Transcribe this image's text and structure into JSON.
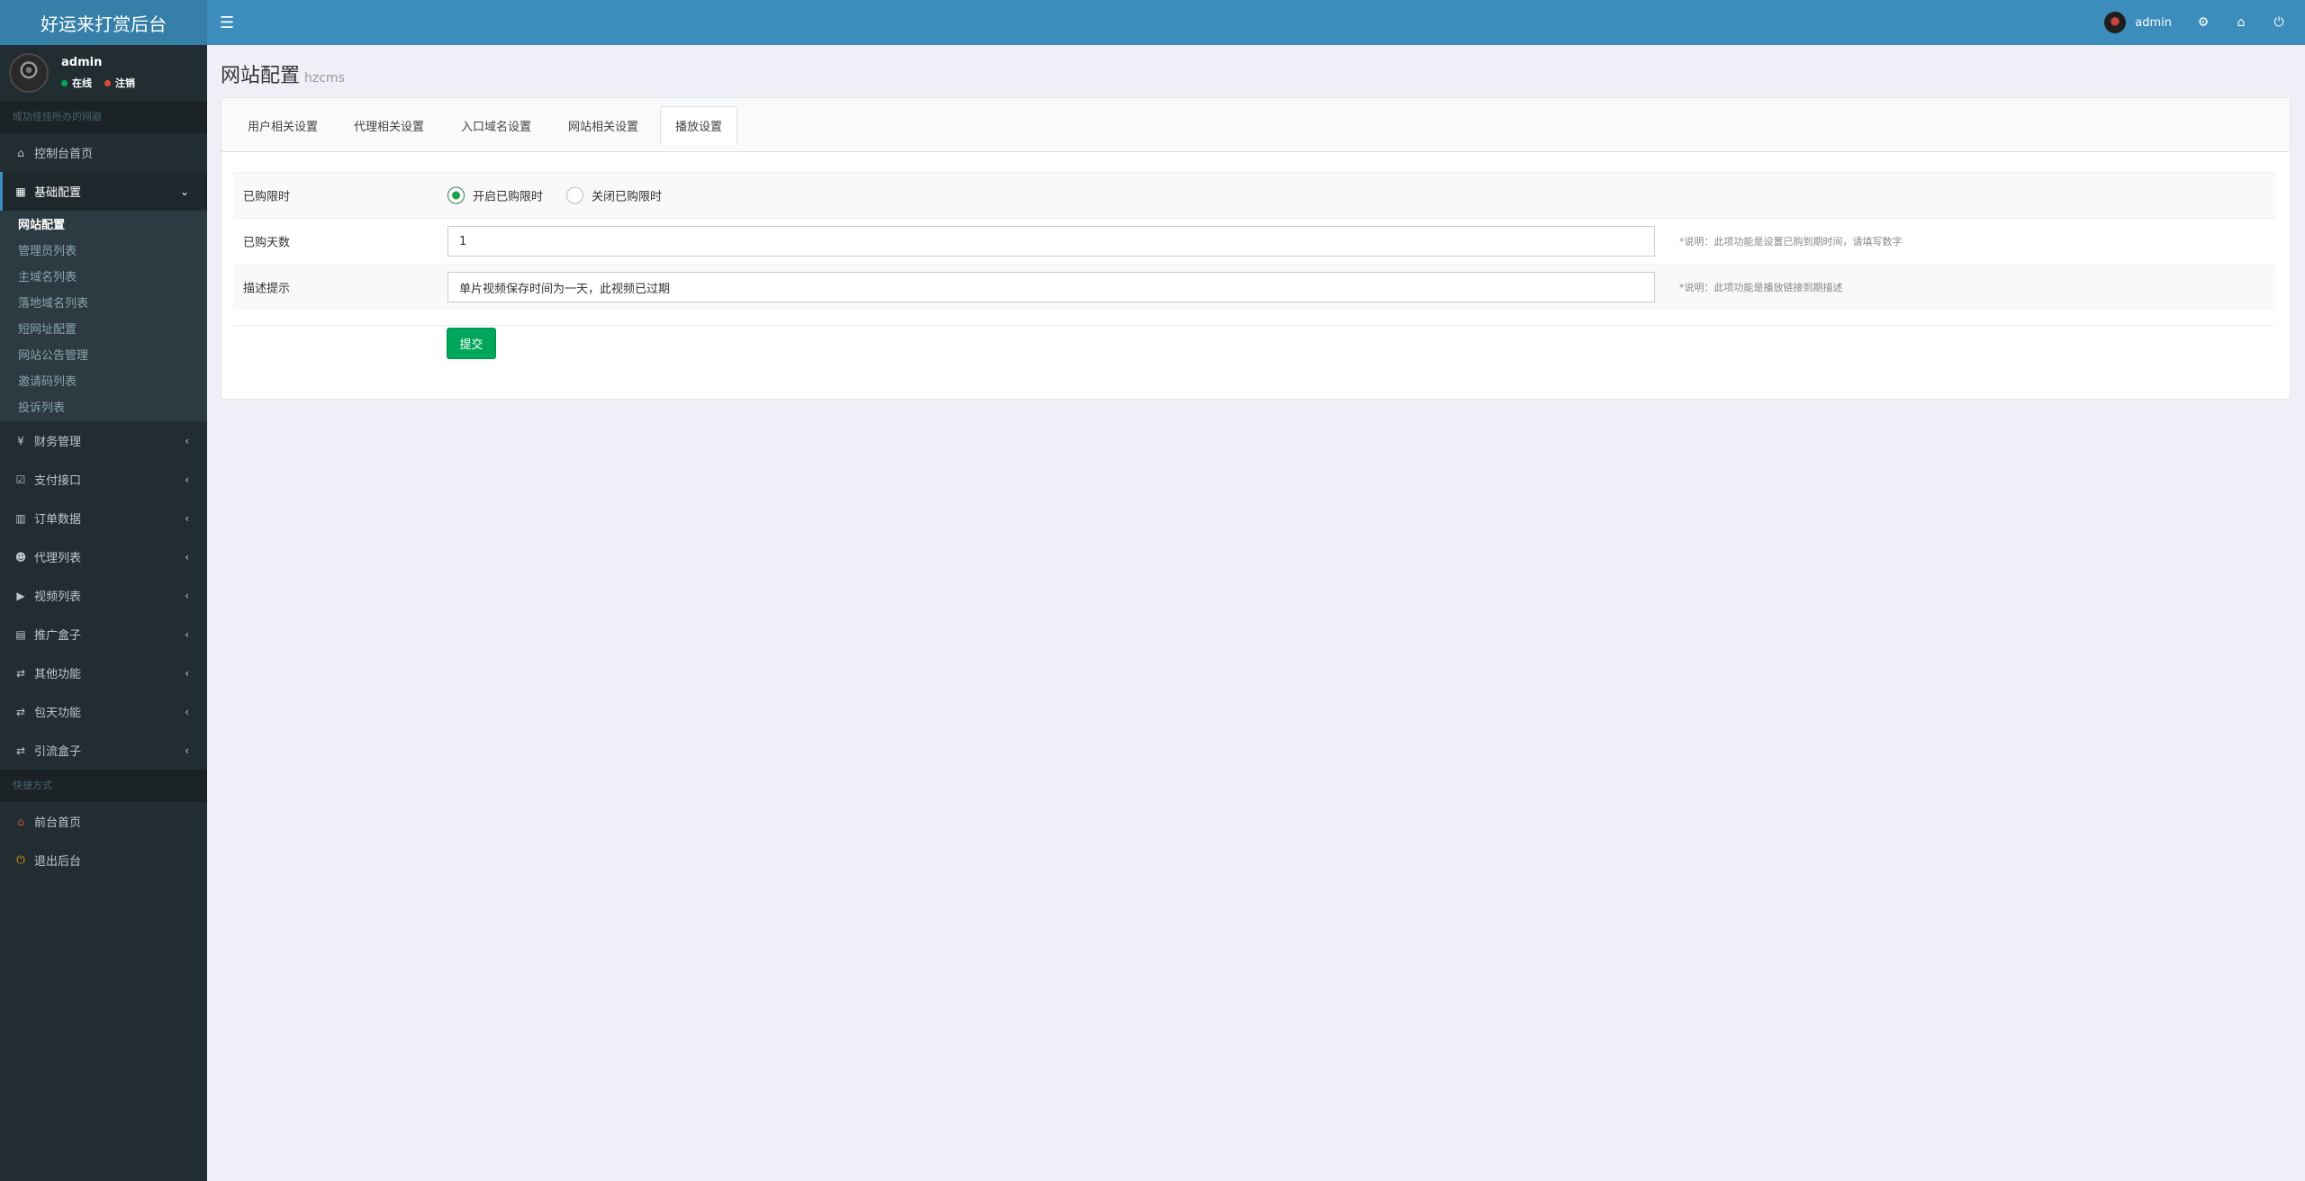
{
  "app": {
    "title": "好运来打赏后台"
  },
  "header": {
    "user_name": "admin"
  },
  "sidebar": {
    "user": {
      "name": "admin",
      "online_label": "在线",
      "logout_label": "注销"
    },
    "section_title": "成功佳佳所办的网避",
    "items": [
      {
        "icon": "dashboard-icon",
        "glyph": "⌂",
        "label": "控制台首页"
      },
      {
        "icon": "grid-icon",
        "glyph": "▦",
        "label": "基础配置",
        "expanded": true
      }
    ],
    "submenu": [
      {
        "label": "网站配置",
        "current": true
      },
      {
        "label": "管理员列表"
      },
      {
        "label": "主域名列表"
      },
      {
        "label": "落地域名列表"
      },
      {
        "label": "短网址配置"
      },
      {
        "label": "网站公告管理"
      },
      {
        "label": "邀请码列表"
      },
      {
        "label": "投诉列表"
      }
    ],
    "items2": [
      {
        "icon": "yen-icon",
        "glyph": "¥",
        "label": "财务管理"
      },
      {
        "icon": "check-square-icon",
        "glyph": "☑",
        "label": "支付接口"
      },
      {
        "icon": "bar-chart-icon",
        "glyph": "▥",
        "label": "订单数据"
      },
      {
        "icon": "users-icon",
        "glyph": "☻",
        "label": "代理列表"
      },
      {
        "icon": "video-icon",
        "glyph": "▶",
        "label": "视频列表"
      },
      {
        "icon": "table-icon",
        "glyph": "▤",
        "label": "推广盒子"
      },
      {
        "icon": "retweet-icon",
        "glyph": "⇄",
        "label": "其他功能"
      },
      {
        "icon": "retweet-icon",
        "glyph": "⇄",
        "label": "包天功能"
      },
      {
        "icon": "retweet-icon",
        "glyph": "⇄",
        "label": "引流盒子"
      }
    ],
    "shortcut_title": "快捷方式",
    "shortcuts": [
      {
        "icon": "home-icon",
        "glyph": "⌂",
        "label": "前台首页",
        "color": "#dd4b39"
      },
      {
        "icon": "power-icon",
        "glyph": "⏻",
        "label": "退出后台",
        "color": "#f39c12"
      }
    ]
  },
  "page": {
    "title": "网站配置",
    "subtitle": "hzcms"
  },
  "tabs": [
    "用户相关设置",
    "代理相关设置",
    "入口域名设置",
    "网站相关设置",
    "播放设置"
  ],
  "active_tab": 4,
  "form": {
    "purchase_limit": {
      "label": "已购限时",
      "options": [
        "开启已购限时",
        "关闭已购限时"
      ],
      "selected": 0
    },
    "purchase_days": {
      "label": "已购天数",
      "value": "1",
      "help": "*说明：此项功能是设置已购到期时间，请填写数字"
    },
    "description": {
      "label": "描述提示",
      "value": "单片视频保存时间为一天，此视频已过期",
      "help": "*说明：此项功能是播放链接到期描述"
    },
    "submit_label": "提交"
  },
  "colors": {
    "header": "#3c8dbc",
    "logo": "#367fa9",
    "sidebar": "#222d32",
    "submit": "#00a65a"
  }
}
